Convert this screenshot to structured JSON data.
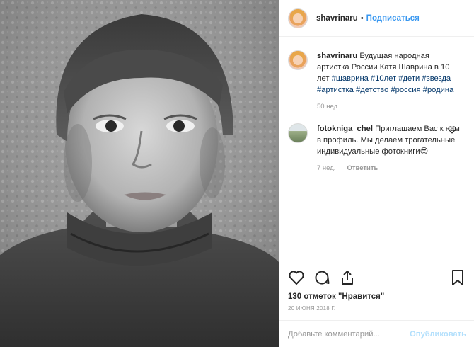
{
  "header": {
    "username": "shavrinaru",
    "separator": "•",
    "follow_label": "Подписаться"
  },
  "caption": {
    "username": "shavrinaru",
    "text": "Будущая народная артистка России Катя Шаврина в 10 лет",
    "tags": [
      "#шаврина",
      "#10лет",
      "#дети",
      "#звезда",
      "#артистка",
      "#детство",
      "#россия",
      "#родина"
    ],
    "time": "50 нед."
  },
  "comments": [
    {
      "username": "fotokniga_chel",
      "text": "Приглашаем Вас к нам в профиль. Мы делаем трогательные индивидуальные фотокниги",
      "emoji": "😍",
      "time": "7 нед.",
      "reply_label": "Ответить"
    }
  ],
  "actions": {
    "icons": [
      "heart-icon",
      "comment-icon",
      "share-icon",
      "bookmark-icon"
    ],
    "likes_text": "130 отметок \"Нравится\"",
    "date": "20 ИЮНЯ 2018 Г."
  },
  "add_comment": {
    "placeholder": "Добавьте комментарий...",
    "publish_label": "Опубликовать"
  },
  "colors": {
    "link_blue": "#3897f0",
    "hashtag": "#003569",
    "muted": "#999999",
    "publish_disabled": "#b2dffc"
  }
}
